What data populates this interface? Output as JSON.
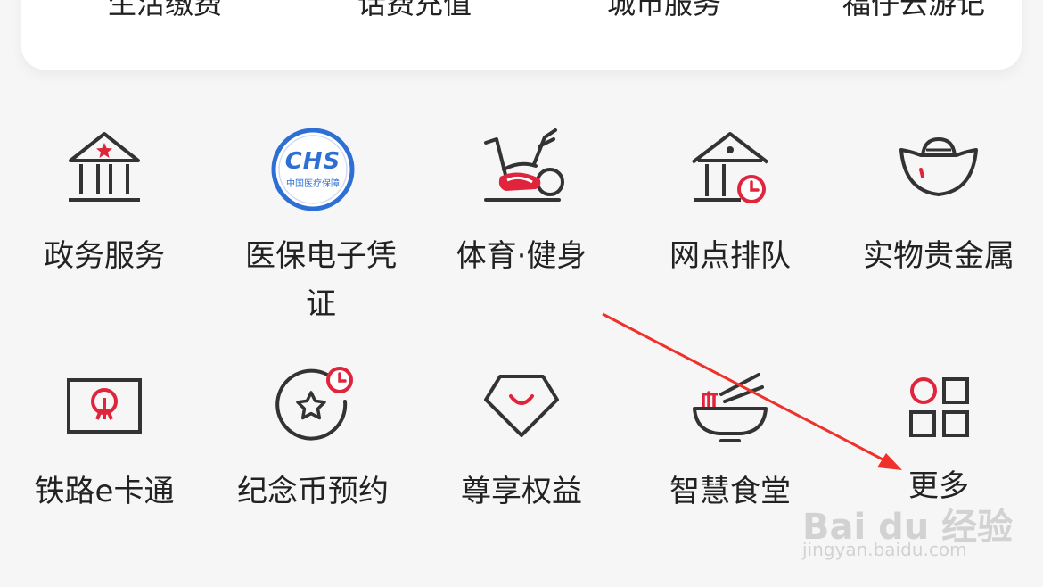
{
  "top_row": [
    "生活缴费",
    "话费充值",
    "城市服务",
    "福仔云游记"
  ],
  "services_row1": [
    {
      "label": "政务服务",
      "icon": "government-building-icon"
    },
    {
      "label": "医保电子凭证",
      "icon": "medical-insurance-logo-icon",
      "logo_text": "CHS",
      "logo_subtext": "中国医疗保障"
    },
    {
      "label": "体育·健身",
      "icon": "exercise-bike-icon"
    },
    {
      "label": "网点排队",
      "icon": "branch-queue-icon"
    },
    {
      "label": "实物贵金属",
      "icon": "gold-ingot-icon"
    }
  ],
  "services_row2": [
    {
      "label": "铁路e卡通",
      "icon": "railway-card-icon"
    },
    {
      "label": "纪念币预约",
      "icon": "commemorative-coin-icon"
    },
    {
      "label": "尊享权益",
      "icon": "diamond-icon"
    },
    {
      "label": "智慧食堂",
      "icon": "noodle-bowl-icon"
    },
    {
      "label": "更多",
      "icon": "more-grid-icon"
    }
  ],
  "watermark": {
    "main": "Bai du 经验",
    "sub": "jingyan.baidu.com"
  },
  "colors": {
    "accent": "#e0243c",
    "icon_dark": "#333333",
    "chs_blue": "#2d6fd4",
    "arrow": "#f0302a"
  }
}
